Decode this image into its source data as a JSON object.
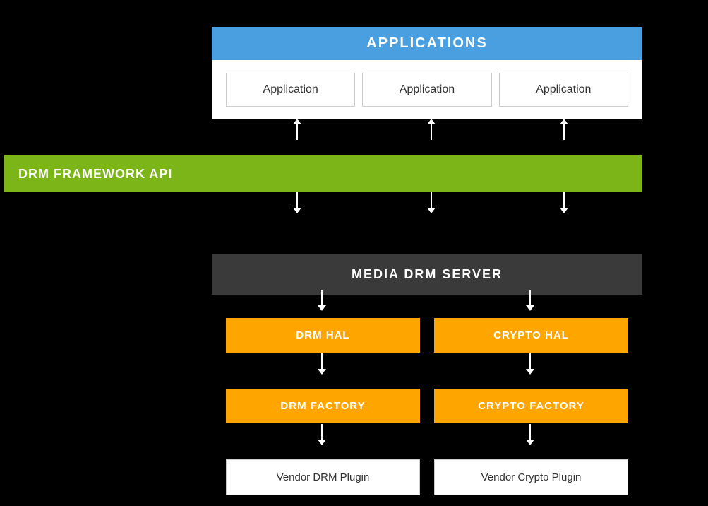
{
  "applications": {
    "header": "APPLICATIONS",
    "app1": "Application",
    "app2": "Application",
    "app3": "Application"
  },
  "drm_framework": {
    "label": "DRM FRAMEWORK API"
  },
  "media_drm_server": {
    "label": "MEDIA DRM SERVER"
  },
  "hal_row": {
    "left": "DRM HAL",
    "right": "CRYPTO HAL"
  },
  "factory_row": {
    "left": "DRM FACTORY",
    "right": "CRYPTO FACTORY"
  },
  "vendor_row": {
    "left": "Vendor DRM Plugin",
    "right": "Vendor Crypto Plugin"
  },
  "colors": {
    "blue": "#4A9FE0",
    "green": "#7CB518",
    "dark_gray": "#3a3a3a",
    "orange": "#FFA500",
    "white": "#ffffff",
    "black": "#000000"
  }
}
